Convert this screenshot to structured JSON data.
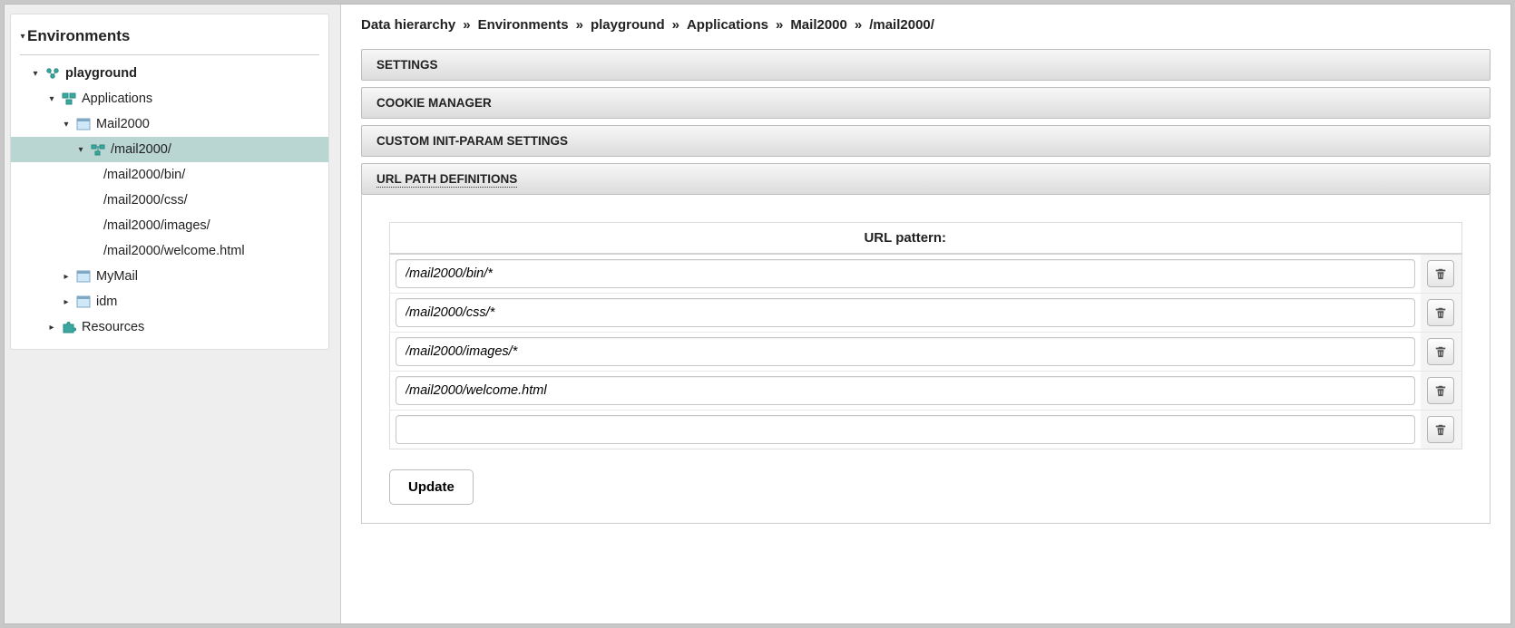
{
  "tree": {
    "title": "Environments",
    "playground": "playground",
    "applications": "Applications",
    "mail2000": "Mail2000",
    "mail2000_root": "/mail2000/",
    "children": [
      "/mail2000/bin/",
      "/mail2000/css/",
      "/mail2000/images/",
      "/mail2000/welcome.html"
    ],
    "mymail": "MyMail",
    "idm": "idm",
    "resources": "Resources"
  },
  "breadcrumb": {
    "b0": "Data hierarchy",
    "b1": "Environments",
    "b2": "playground",
    "b3": "Applications",
    "b4": "Mail2000",
    "b5": "/mail2000/",
    "sep": "»"
  },
  "sections": {
    "settings": "SETTINGS",
    "cookie": "COOKIE MANAGER",
    "initparam": "CUSTOM INIT-PARAM SETTINGS",
    "urlpath": "URL PATH DEFINITIONS"
  },
  "urlPatternTable": {
    "header": "URL pattern:",
    "rows": [
      "/mail2000/bin/*",
      "/mail2000/css/*",
      "/mail2000/images/*",
      "/mail2000/welcome.html",
      ""
    ]
  },
  "buttons": {
    "update": "Update"
  }
}
